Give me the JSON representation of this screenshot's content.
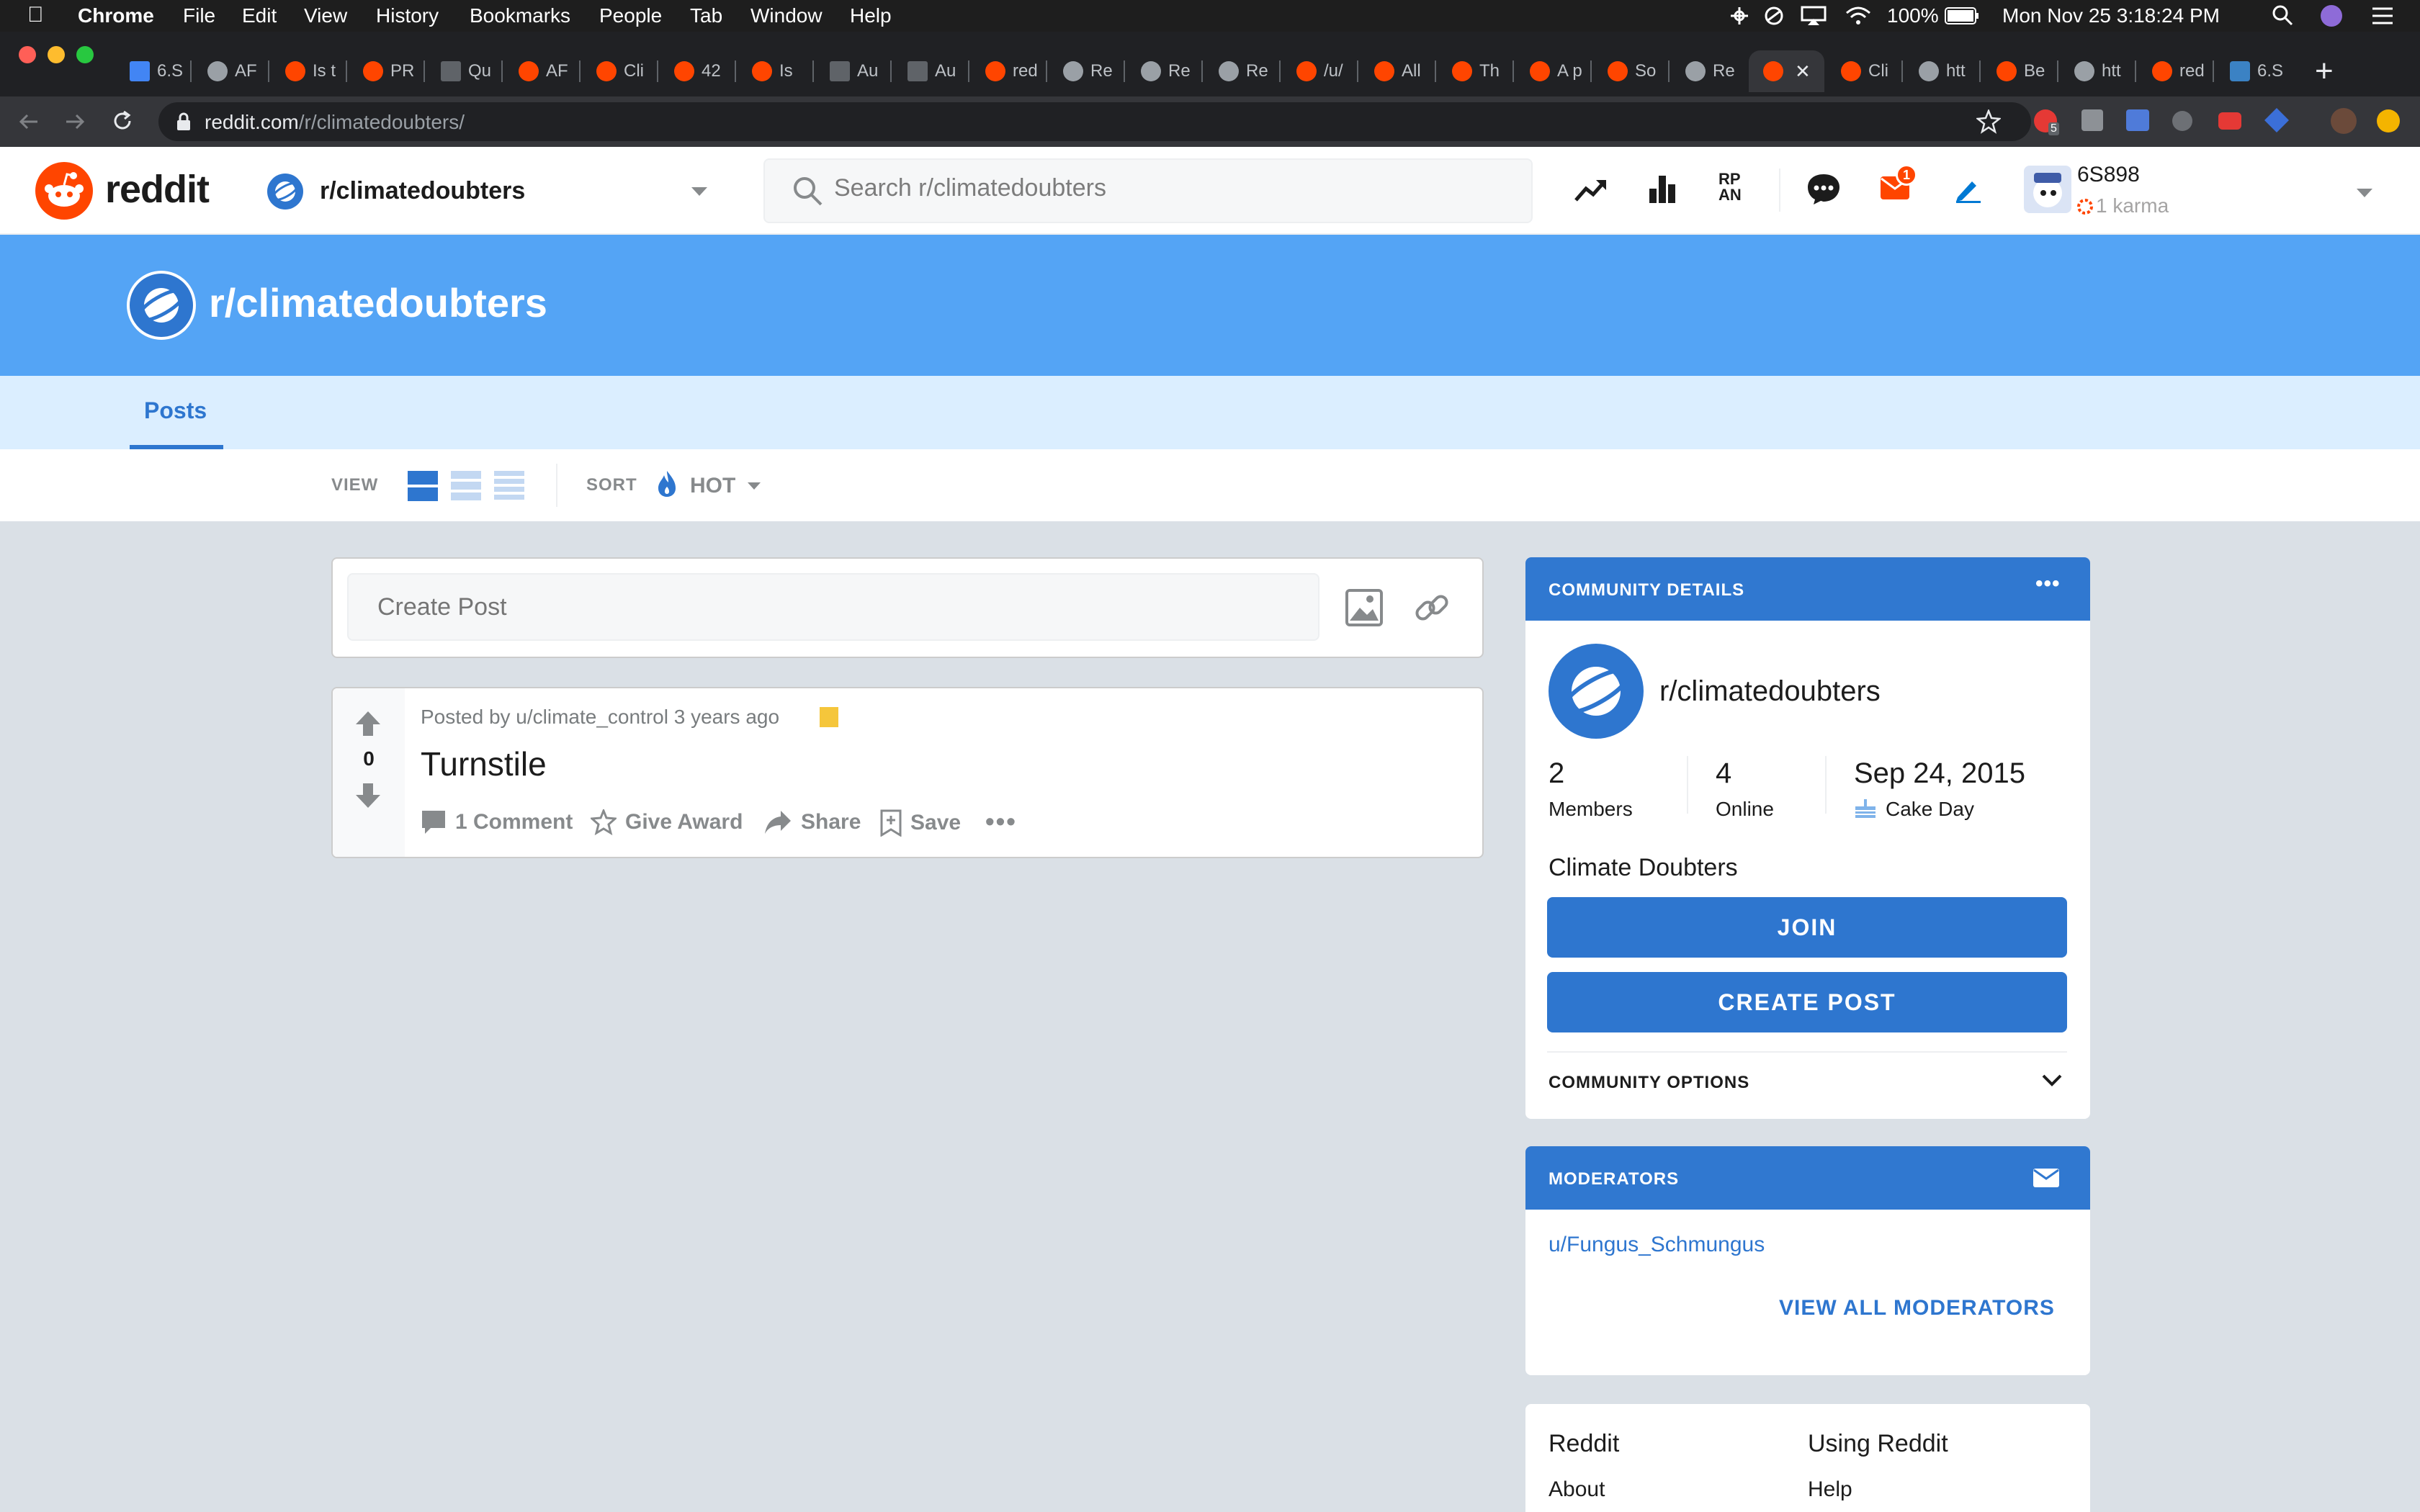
{
  "menubar": {
    "app": "Chrome",
    "menus": [
      "File",
      "Edit",
      "View",
      "History",
      "Bookmarks",
      "People",
      "Tab",
      "Window",
      "Help"
    ],
    "battery": "100%",
    "datetime": "Mon Nov 25  3:18:24 PM"
  },
  "tabs": [
    {
      "label": "6.S",
      "icon": "doc"
    },
    {
      "label": "AF",
      "icon": "globe"
    },
    {
      "label": "Is t",
      "icon": "reddit"
    },
    {
      "label": "PR",
      "icon": "reddit"
    },
    {
      "label": "Qu",
      "icon": "sheet"
    },
    {
      "label": "AF",
      "icon": "reddit"
    },
    {
      "label": "Cli",
      "icon": "reddit"
    },
    {
      "label": "42",
      "icon": "reddit"
    },
    {
      "label": "Is",
      "icon": "reddit"
    },
    {
      "label": "Au",
      "icon": "sheet"
    },
    {
      "label": "Au",
      "icon": "sheet"
    },
    {
      "label": "red",
      "icon": "reddit"
    },
    {
      "label": "Re",
      "icon": "globe"
    },
    {
      "label": "Re",
      "icon": "globe"
    },
    {
      "label": "Re",
      "icon": "globe"
    },
    {
      "label": "/u/",
      "icon": "reddit"
    },
    {
      "label": "All",
      "icon": "reddit"
    },
    {
      "label": "Th",
      "icon": "reddit"
    },
    {
      "label": "A p",
      "icon": "reddit"
    },
    {
      "label": "So",
      "icon": "reddit"
    },
    {
      "label": "Re",
      "icon": "globe"
    },
    {
      "label": "",
      "icon": "reddit",
      "active": true
    },
    {
      "label": "Cli",
      "icon": "reddit"
    },
    {
      "label": "htt",
      "icon": "globe"
    },
    {
      "label": "Be",
      "icon": "reddit"
    },
    {
      "label": "htt",
      "icon": "globe"
    },
    {
      "label": "red",
      "icon": "reddit"
    },
    {
      "label": "6.S",
      "icon": "p"
    }
  ],
  "browser": {
    "url_host": "reddit.com",
    "url_path": "/r/climatedoubters/"
  },
  "header": {
    "logo_text": "reddit",
    "community": "r/climatedoubters",
    "search_placeholder": "Search r/climatedoubters",
    "mail_badge": "1",
    "username": "6S898",
    "karma": "1 karma"
  },
  "banner": {
    "title": "r/climatedoubters"
  },
  "nav": {
    "tab_posts": "Posts"
  },
  "sortbar": {
    "view_label": "VIEW",
    "sort_label": "SORT",
    "sort_value": "HOT"
  },
  "create_post": {
    "placeholder": "Create Post"
  },
  "post": {
    "votes": "0",
    "meta": "Posted by u/climate_control 3 years ago",
    "title": "Turnstile",
    "comments": "1 Comment",
    "award": "Give Award",
    "share": "Share",
    "save": "Save"
  },
  "community": {
    "header": "COMMUNITY DETAILS",
    "name": "r/climatedoubters",
    "members_count": "2",
    "members_label": "Members",
    "online_count": "4",
    "online_label": "Online",
    "cake_date": "Sep 24, 2015",
    "cake_label": "Cake Day",
    "description": "Climate Doubters",
    "join": "JOIN",
    "create_post": "CREATE POST",
    "options": "COMMUNITY OPTIONS"
  },
  "moderators": {
    "header": "MODERATORS",
    "list": [
      "u/Fungus_Schmungus"
    ],
    "view_all": "VIEW ALL MODERATORS"
  },
  "footer": {
    "col1_title": "Reddit",
    "col1_items": [
      "About"
    ],
    "col2_title": "Using Reddit",
    "col2_items": [
      "Help"
    ]
  },
  "colors": {
    "reddit_orange": "#ff4500",
    "banner_blue": "#54a4f5",
    "button_blue": "#2e76cf",
    "nav_light_blue": "#dbeeff"
  }
}
